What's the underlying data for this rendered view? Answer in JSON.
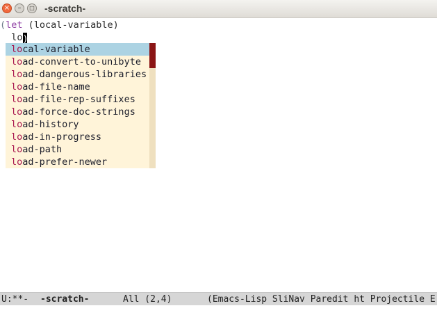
{
  "window": {
    "title": "-scratch-",
    "close_glyph": "×",
    "minimize_glyph": "–",
    "maximize_glyph": "□"
  },
  "editor": {
    "line1": {
      "open_paren": "(",
      "keyword": "let",
      "rest": " (local-variable)"
    },
    "line2": {
      "indent": "  ",
      "typed": "lo",
      "cursor_char": ")"
    }
  },
  "completion": {
    "prefix": "lo",
    "items": [
      {
        "match": "lo",
        "rest": "cal-variable",
        "selected": true
      },
      {
        "match": "lo",
        "rest": "ad-convert-to-unibyte",
        "selected": false
      },
      {
        "match": "lo",
        "rest": "ad-dangerous-libraries",
        "selected": false
      },
      {
        "match": "lo",
        "rest": "ad-file-name",
        "selected": false
      },
      {
        "match": "lo",
        "rest": "ad-file-rep-suffixes",
        "selected": false
      },
      {
        "match": "lo",
        "rest": "ad-force-doc-strings",
        "selected": false
      },
      {
        "match": "lo",
        "rest": "ad-history",
        "selected": false
      },
      {
        "match": "lo",
        "rest": "ad-in-progress",
        "selected": false
      },
      {
        "match": "lo",
        "rest": "ad-path",
        "selected": false
      },
      {
        "match": "lo",
        "rest": "ad-prefer-newer",
        "selected": false
      }
    ],
    "scroll_fraction_visible": 0.2,
    "colors": {
      "selected_bg": "#acd3e3",
      "popup_bg": "#fff4d9",
      "match_fg": "#a8154d",
      "thumb": "#8b1515"
    }
  },
  "modeline": {
    "status": "U:**-",
    "buffer": "-scratch-",
    "position": "All (2,4)",
    "modes": "(Emacs-Lisp SliNav Paredit ht Projectile E"
  }
}
